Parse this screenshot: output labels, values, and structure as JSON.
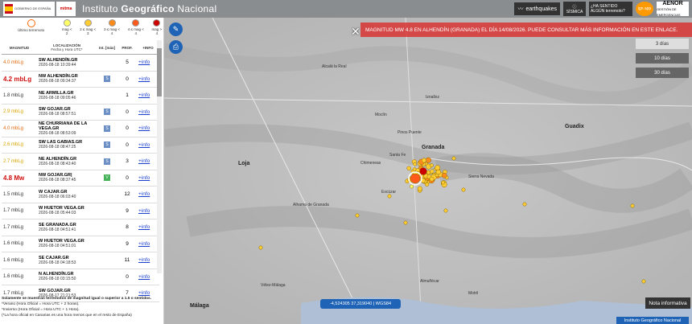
{
  "header": {
    "gov_text": "GOBIERNO DE ESPAÑA",
    "ministry": "MINISTERIO DE TRANSPORTES, MOVILIDAD Y AGENDA URBANA",
    "mitma": "mitma",
    "title_a": "Instituto",
    "title_b": "Geográfico",
    "title_c": "Nacional",
    "earthquakes": "earthquakes",
    "sismica_label": "SÍSMICA",
    "felt_label": "¿HA SENTIDO ALGÚN terremoto?",
    "app_label": "ign app",
    "aenor": "AENOR",
    "aenor_sub": "GESTIÓN DE EMERGENCIAS"
  },
  "legend": {
    "last": "Último terremoto",
    "items": [
      {
        "label": "mag < 2",
        "color": "#ffff66"
      },
      {
        "label": "2 ≤ mag < 3",
        "color": "#ffcc33"
      },
      {
        "label": "3 ≤ mag < 4",
        "color": "#ff8c1a"
      },
      {
        "label": "4 ≤ mag < 4",
        "color": "#ff5a1a"
      },
      {
        "label": "mag > 4",
        "color": "#cc0000"
      }
    ]
  },
  "table": {
    "headers": {
      "mag": "MAGNITUD",
      "loc": "LOCALIZACIÓN",
      "loc_sub": "Fecha y Hora UTC*",
      "int": "Int. [máx]",
      "prof": "PROF.",
      "info": "+INFO"
    },
    "rows": [
      {
        "mag": "4.0 mbLg",
        "color": "#e06a10",
        "loc": "SW ALHENDÍN.GR",
        "date": "2026-08-18 10:39:44",
        "int": "",
        "prof": "5",
        "info": "+info"
      },
      {
        "mag": "4.2 mbLg",
        "color": "#d01010",
        "loc": "NW ALHENDÍN.GR",
        "date": "2026-08-18 09:34:37",
        "int": "S",
        "prof": "0",
        "info": "+info"
      },
      {
        "mag": "1.8 mbLg",
        "color": "#333333",
        "loc": "NE ARMILLA.GR",
        "date": "2026-08-18 09:05:46",
        "int": "",
        "prof": "1",
        "info": "+info"
      },
      {
        "mag": "2.9 mbLg",
        "color": "#d9a400",
        "loc": "SW GOJAR.GR",
        "date": "2026-08-18 08:57:51",
        "int": "S",
        "prof": "0",
        "info": "+info"
      },
      {
        "mag": "4.0 mbLg",
        "color": "#e06a10",
        "loc": "NE CHURRIANA DE LA VEGA.GR",
        "date": "2026-08-18 08:53:09",
        "int": "S",
        "prof": "0",
        "info": "+info"
      },
      {
        "mag": "2.6 mbLg",
        "color": "#d9a400",
        "loc": "SW LAS GABIAS.GR",
        "date": "2026-08-18 08:47:25",
        "int": "S",
        "prof": "0",
        "info": "+info"
      },
      {
        "mag": "2.7 mbLg",
        "color": "#d9a400",
        "loc": "NE ALHENDÍN.GR",
        "date": "2026-08-18 08:43:40",
        "int": "S",
        "prof": "3",
        "info": "+info"
      },
      {
        "mag": "4.8 Mw",
        "color": "#d01010",
        "loc": "NW GOJAR.GR|",
        "date": "2026-08-18 08:37:45",
        "int": "V",
        "prof": "0",
        "info": "+info"
      },
      {
        "mag": "1.5 mbLg",
        "color": "#333333",
        "loc": "W CAJAR.GR",
        "date": "2026-08-18 06:03:40",
        "int": "",
        "prof": "12",
        "info": "+info"
      },
      {
        "mag": "1.7 mbLg",
        "color": "#333333",
        "loc": "W HUETOR VEGA.GR",
        "date": "2026-08-18 05:44:03",
        "int": "",
        "prof": "9",
        "info": "+info"
      },
      {
        "mag": "1.7 mbLg",
        "color": "#333333",
        "loc": "SE GRANADA.GR",
        "date": "2026-08-18 04:51:41",
        "int": "",
        "prof": "8",
        "info": "+info"
      },
      {
        "mag": "1.6 mbLg",
        "color": "#333333",
        "loc": "W HUETOR VEGA.GR",
        "date": "2026-08-18 04:51:01",
        "int": "",
        "prof": "9",
        "info": "+info"
      },
      {
        "mag": "1.6 mbLg",
        "color": "#333333",
        "loc": "SE CAJAR.GR",
        "date": "2026-08-18 04:18:53",
        "int": "",
        "prof": "11",
        "info": "+info"
      },
      {
        "mag": "1.6 mbLg",
        "color": "#333333",
        "loc": "N ALHENDÍN.GR",
        "date": "2026-08-18 03:15:50",
        "int": "",
        "prof": "0",
        "info": "+info"
      },
      {
        "mag": "1.7 mbLg",
        "color": "#333333",
        "loc": "SW GOJAR.GR",
        "date": "2026-08-17 21:21:53",
        "int": "",
        "prof": "7",
        "info": "+info"
      }
    ]
  },
  "footnote": {
    "l1": "Solamente se muestran terremotos de magnitud igual o superior a 1.5 o sentidos.",
    "l2": "*Verano (Hora Oficial = Hora UTC + 2 horas).",
    "l3": "*Invierno (Hora Oficial = Hora UTC + 1 Hora).",
    "l4": "(*La hora oficial en Canarias es una hora menos que en el resto de España)"
  },
  "map": {
    "banner": "MAGNITUD MW 4.8 EN ALHENDÍN (GRANADA) EL DÍA 14/08/2026. PUEDE CONSULTAR MÁS INFORMACIÓN EN ESTE ENLACE.",
    "days": [
      "3 días",
      "10 días",
      "30 días"
    ],
    "coords": "-4,524305   37,319040 | WGS84",
    "nota": "Nota informativa",
    "credit": "Instituto Geográfico Nacional",
    "places": {
      "granada": "Granada",
      "loja": "Loja",
      "alhama": "Alhama de Granada",
      "guadix": "Guadix",
      "malaga": "Málaga",
      "motril": "Motril",
      "alcala": "Alcalá la Real",
      "iznalloz": "Iznalloz",
      "santafe": "Santa Fe",
      "chimeneas": "Chimeneas",
      "escuzar": "Escúzar",
      "sierranevada": "Sierra Nevada",
      "velez": "Vélez-Málaga",
      "almunecar": "Almuñécar",
      "pinos": "Pinos Puente",
      "moclin": "Moclín"
    }
  }
}
